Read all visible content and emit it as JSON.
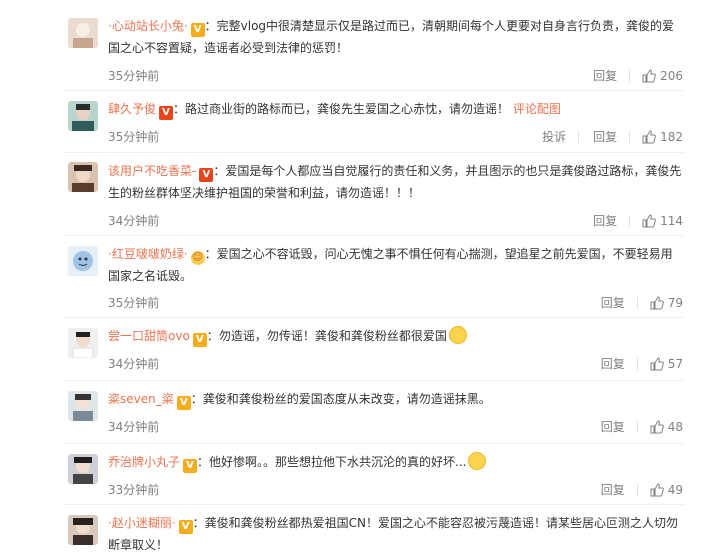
{
  "header_strip": [
    "·",
    "·",
    "·"
  ],
  "comments": [
    {
      "username": "·心动站长小兔·",
      "badge": "V",
      "badge_type": "gold",
      "text": "完整vlog中很清楚显示仅是路过而已，清朝期间每个人更要对自身言行负责，龚俊的爱国之心不容置疑，造谣者必受到法律的惩罚！",
      "time": "35分钟前",
      "reply": "回复",
      "likes": "206",
      "report": ""
    },
    {
      "username": "肆久予俊",
      "badge": "V",
      "badge_type": "red",
      "text": "路过商业街的路标而已，龚俊先生爱国之心赤忱，请勿造谣！",
      "link": "评论配图",
      "time": "35分钟前",
      "reply": "回复",
      "likes": "182",
      "report": "投诉"
    },
    {
      "username": "该用户不吃香菜-",
      "badge": "V",
      "badge_type": "red",
      "text": "爱国是每个人都应当自觉履行的责任和义务，并且图示的也只是龚俊路过路标，龚俊先生的粉丝群体坚决维护祖国的荣誉和利益，请勿造谣！！！",
      "time": "34分钟前",
      "reply": "回复",
      "likes": "114",
      "report": ""
    },
    {
      "username": "·红豆啵啵奶绿·",
      "badge": "☺",
      "badge_type": "emoji",
      "text": "爱国之心不容诋毁，问心无愧之事不惧任何有心揣测，望追星之前先爱国，不要轻易用国家之名诋毁。",
      "time": "35分钟前",
      "reply": "回复",
      "likes": "79",
      "report": ""
    },
    {
      "username": "尝一口甜筒ovo",
      "badge": "V",
      "badge_type": "gold",
      "text": "勿造谣，勿传谣！龚俊和龚俊粉丝都很爱国",
      "time": "34分钟前",
      "reply": "回复",
      "likes": "57",
      "report": ""
    },
    {
      "username": "粢seven_粢",
      "badge": "V",
      "badge_type": "gold",
      "text": "龚俊和龚俊粉丝的爱国态度从未改变，请勿造谣抹黑。",
      "time": "34分钟前",
      "reply": "回复",
      "likes": "48",
      "report": ""
    },
    {
      "username": "乔治牌小丸子",
      "badge": "V",
      "badge_type": "gold",
      "text": "他好惨啊。。那些想拉他下水共沉沦的真的好坏...",
      "time": "33分钟前",
      "reply": "回复",
      "likes": "49",
      "report": ""
    },
    {
      "username": "·赵小迷糊丽·",
      "badge": "V",
      "badge_type": "gold",
      "text": "龚俊和龚俊粉丝都热爱祖国CN！爱国之心不能容忍被污蔑造谣！请某些居心叵测之人切勿断章取义！",
      "time": "",
      "reply": "",
      "likes": "",
      "report": ""
    }
  ],
  "colors": {
    "username": "#eb7350",
    "meta": "#808080",
    "text": "#333333",
    "badge_gold": "#f7ad1b",
    "badge_red": "#e8451b"
  },
  "icons": {
    "like": "thumbs-up-icon",
    "avatar": "avatar-image"
  }
}
